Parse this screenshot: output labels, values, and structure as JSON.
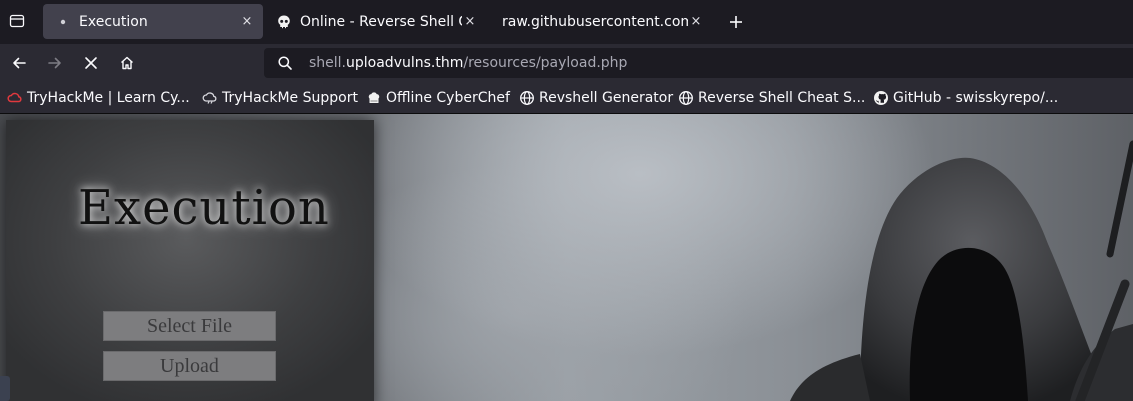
{
  "tabs": [
    {
      "title": "Execution",
      "active": true,
      "favicon": "page-dot-icon"
    },
    {
      "title": "Online - Reverse Shell Ge",
      "active": false,
      "favicon": "skull-icon"
    },
    {
      "title": "raw.githubusercontent.com/",
      "active": false,
      "favicon": "none"
    }
  ],
  "tab_close_glyph": "×",
  "new_tab_glyph": "+",
  "urlbar": {
    "prefix": "shell.",
    "host": "uploadvulns.thm",
    "path": "/resources/payload.php"
  },
  "bookmarks": [
    {
      "label": "TryHackMe | Learn Cy...",
      "icon": "tryhackme-icon"
    },
    {
      "label": "TryHackMe Support",
      "icon": "tryhackme-support-icon"
    },
    {
      "label": "Offline CyberChef",
      "icon": "cyberchef-icon"
    },
    {
      "label": "Revshell Generator",
      "icon": "globe-icon"
    },
    {
      "label": "Reverse Shell Cheat S...",
      "icon": "globe-icon"
    },
    {
      "label": "GitHub - swisskyrepo/...",
      "icon": "github-icon"
    }
  ],
  "page": {
    "title": "Execution",
    "select_file_label": "Select File",
    "upload_label": "Upload"
  },
  "colors": {
    "chrome_bg": "#1c1b22",
    "toolbar_bg": "#2b2a33",
    "active_tab_bg": "#42414d",
    "page_button_bg": "#7d7d7f"
  }
}
